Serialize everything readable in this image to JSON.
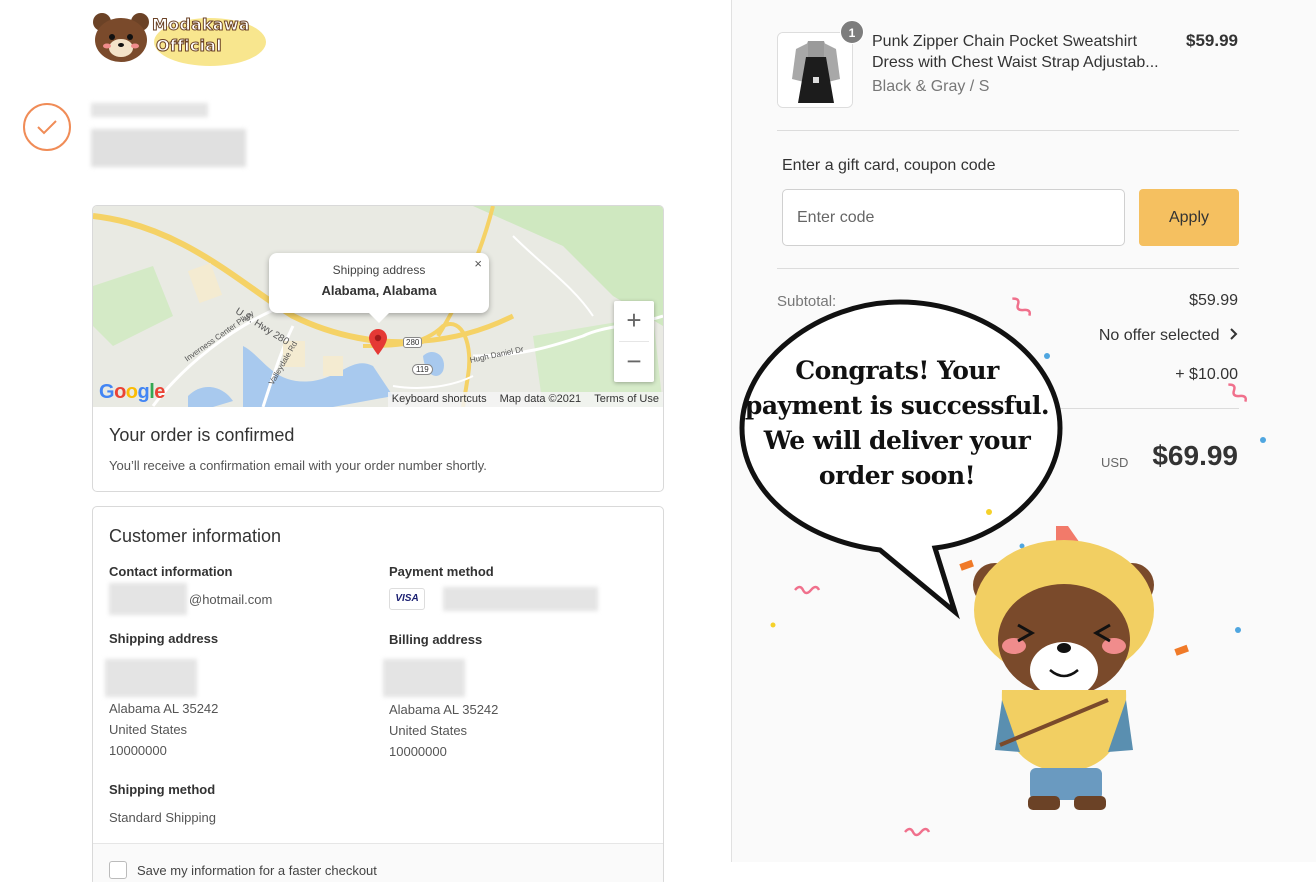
{
  "brand": {
    "logo_line1": "Modakawa",
    "logo_line2": "Official"
  },
  "map": {
    "popup_title": "Shipping address",
    "popup_value": "Alabama, Alabama",
    "popup_close": "×",
    "zoom_in": "+",
    "zoom_out": "−",
    "road_label_1": "U.S. Hwy 280",
    "road_label_2": "Inverness Center Pkwy",
    "road_label_3": "Valleydale Rd",
    "road_label_4": "Hugh Daniel Dr",
    "shield_1": "280",
    "shield_2": "119",
    "google": "Google",
    "footer": [
      "Keyboard shortcuts",
      "Map data ©2021",
      "Terms of Use"
    ]
  },
  "confirmation": {
    "title": "Your order is confirmed",
    "subtitle": "You’ll receive a confirmation email with your order number shortly."
  },
  "customer": {
    "title": "Customer information",
    "contact_label": "Contact information",
    "contact_email_suffix": "@hotmail.com",
    "payment_label": "Payment method",
    "payment_brand": "VISA",
    "shipping_label": "Shipping address",
    "shipping_lines": [
      "Alabama AL 35242",
      "United States",
      "10000000"
    ],
    "billing_label": "Billing address",
    "billing_lines": [
      "Alabama AL 35242",
      "United States",
      "10000000"
    ],
    "method_label": "Shipping method",
    "method_value": "Standard Shipping",
    "save_label": "Save my information for a faster checkout"
  },
  "order": {
    "quantity": "1",
    "product_line1": "Punk Zipper Chain Pocket Sweatshirt",
    "product_line2": "Dress with Chest Waist Strap Adjustab...",
    "variant": "Black & Gray / S",
    "price": "$59.99",
    "gift_label": "Enter a gift card, coupon code",
    "code_placeholder": "Enter code",
    "apply_label": "Apply",
    "subtotal_label": "Subtotal:",
    "subtotal_value": "$59.99",
    "offer_label": "No offer selected",
    "shipping_value": "+ $10.00",
    "currency": "USD",
    "total": "$69.99"
  },
  "overlay": {
    "message": "Congrats! Your payment is successful. We will deliver your order soon!"
  },
  "colors": {
    "accent": "#f08c57",
    "apply": "#f5c060",
    "pin": "#e53935"
  }
}
